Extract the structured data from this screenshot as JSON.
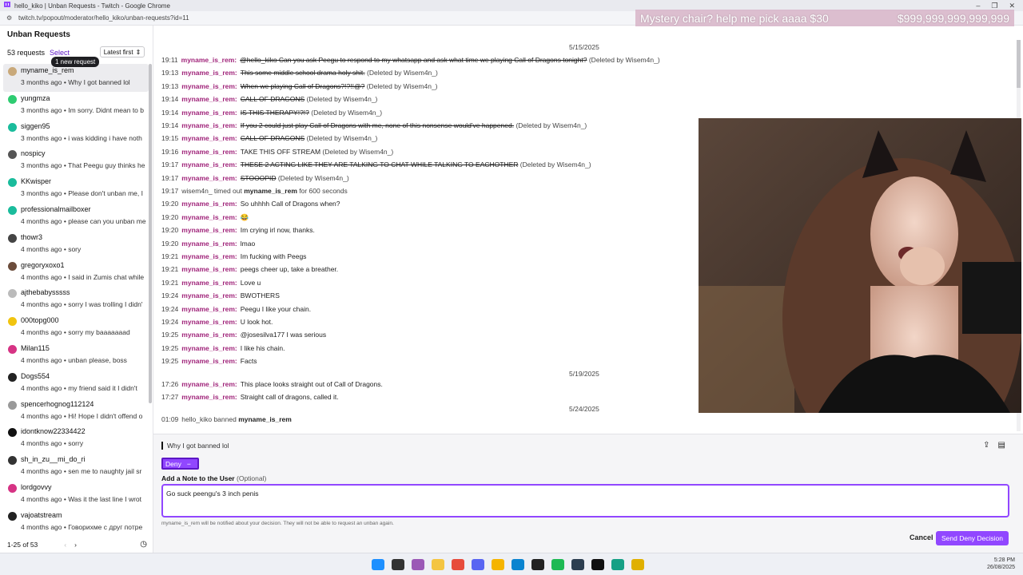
{
  "browser": {
    "title": "hello_kiko | Unban Requests - Twitch - Google Chrome",
    "url": "twitch.tv/popout/moderator/hello_kiko/unban-requests?id=11"
  },
  "overlay": {
    "left": "Mystery chair? help me pick aaaa $30",
    "right": "$999,999,999,999,999"
  },
  "sidebar": {
    "heading": "Unban Requests",
    "count": "53 requests",
    "select": "Select",
    "sort": "Latest first",
    "tooltip": "1 new request",
    "pager": "1-25 of 53",
    "items": [
      {
        "name": "myname_is_rem",
        "meta": "3 months ago • Why I got banned lol",
        "color": "#c9a97a"
      },
      {
        "name": "yungmza",
        "meta": "3 months ago • Im sorry. Didnt mean to b",
        "color": "#2ecc71"
      },
      {
        "name": "siggen95",
        "meta": "3 months ago • i was kidding i have noth",
        "color": "#1abc9c"
      },
      {
        "name": "nospicy",
        "meta": "3 months ago • That Peegu guy thinks he",
        "color": "#555555"
      },
      {
        "name": "KKwisper",
        "meta": "3 months ago • Please don't unban me, I",
        "color": "#1abc9c"
      },
      {
        "name": "professionalmailboxer",
        "meta": "4 months ago • please can you unban me",
        "color": "#1abc9c"
      },
      {
        "name": "thowr3",
        "meta": "4 months ago • sory",
        "color": "#444444"
      },
      {
        "name": "gregoryxoxo1",
        "meta": "4 months ago • I said in Zumis chat while",
        "color": "#6b4c3b"
      },
      {
        "name": "ajthebabysssss",
        "meta": "4 months ago • sorry I was trolling I didn'",
        "color": "#bbbbbb"
      },
      {
        "name": "000topg000",
        "meta": "4 months ago • sorry my baaaaaaad",
        "color": "#f1c40f"
      },
      {
        "name": "Milan115",
        "meta": "4 months ago • unban please, boss",
        "color": "#d63384"
      },
      {
        "name": "Dogs554",
        "meta": "4 months ago • my friend said it I didn't",
        "color": "#222222"
      },
      {
        "name": "spencerhognog112124",
        "meta": "4 months ago • Hi! Hope I didn't offend o",
        "color": "#999999"
      },
      {
        "name": "idontknow22334422",
        "meta": "4 months ago • sorry",
        "color": "#111111"
      },
      {
        "name": "sh_in_zu__mi_do_ri",
        "meta": "4 months ago • sen me to naughty jail sr",
        "color": "#333333"
      },
      {
        "name": "lordgovvy",
        "meta": "4 months ago • Was it the last line I wrot",
        "color": "#d63384"
      },
      {
        "name": "vajoatstream",
        "meta": "4 months ago • Говорихме с друг потре",
        "color": "#222222"
      }
    ]
  },
  "chat": {
    "dates": [
      "5/15/2025",
      "5/19/2025",
      "5/24/2025"
    ],
    "lines": [
      {
        "t": "19:11",
        "u": "myname_is_rem:",
        "m": "@hello_kiko Can you ask Peegu to respond to my whatsapp and ask what time we playing Call of Dragons tonight?",
        "del": true,
        "note": "(Deleted by Wisem4n_)"
      },
      {
        "t": "19:13",
        "u": "myname_is_rem:",
        "m": "This some middle school drama holy shit.",
        "del": true,
        "note": "(Deleted by Wisem4n_)"
      },
      {
        "t": "19:13",
        "u": "myname_is_rem:",
        "m": "When we playing Call of Dragons?!?!!@?",
        "del": true,
        "note": "(Deleted by Wisem4n_)"
      },
      {
        "t": "19:14",
        "u": "myname_is_rem:",
        "m": "CALL OF DRAGONS",
        "del": true,
        "note": "(Deleted by Wisem4n_)"
      },
      {
        "t": "19:14",
        "u": "myname_is_rem:",
        "m": "IS THIS THERAPY!?!?",
        "del": true,
        "note": "(Deleted by Wisem4n_)"
      },
      {
        "t": "19:14",
        "u": "myname_is_rem:",
        "m": "If you 2 could just play Call of Dragons with me, none of this nonsense would've happened.",
        "del": true,
        "note": "(Deleted by Wisem4n_)"
      },
      {
        "t": "19:15",
        "u": "myname_is_rem:",
        "m": "CALL OF DRAGONS",
        "del": true,
        "note": "(Deleted by Wisem4n_)"
      },
      {
        "t": "19:16",
        "u": "myname_is_rem:",
        "m": "TAKE THIS OFF STREAM",
        "del": false,
        "note": "(Deleted by Wisem4n_)"
      },
      {
        "t": "19:17",
        "u": "myname_is_rem:",
        "m": "THESE 2 ACTING LIKE THEY ARE TALKING TO CHAT WHILE TALKING TO EACHOTHER",
        "del": true,
        "note": "(Deleted by Wisem4n_)"
      },
      {
        "t": "19:17",
        "u": "myname_is_rem:",
        "m": "STOOOPID",
        "del": true,
        "note": "(Deleted by Wisem4n_)"
      },
      {
        "t": "19:17",
        "sys": "wisem4n_ timed out",
        "sysu": "myname_is_rem",
        "sysend": "for 600 seconds"
      },
      {
        "t": "19:20",
        "u": "myname_is_rem:",
        "m": "So uhhhh Call of Dragons when?"
      },
      {
        "t": "19:20",
        "u": "myname_is_rem:",
        "m": "😂"
      },
      {
        "t": "19:20",
        "u": "myname_is_rem:",
        "m": "Im crying irl now, thanks."
      },
      {
        "t": "19:20",
        "u": "myname_is_rem:",
        "m": "lmao"
      },
      {
        "t": "19:21",
        "u": "myname_is_rem:",
        "m": "Im fucking with Peegs"
      },
      {
        "t": "19:21",
        "u": "myname_is_rem:",
        "m": "peegs cheer up, take a breather."
      },
      {
        "t": "19:21",
        "u": "myname_is_rem:",
        "m": "Love u"
      },
      {
        "t": "19:24",
        "u": "myname_is_rem:",
        "m": "BWOTHERS"
      },
      {
        "t": "19:24",
        "u": "myname_is_rem:",
        "m": "Peegu I like your chain."
      },
      {
        "t": "19:24",
        "u": "myname_is_rem:",
        "m": "U look hot."
      },
      {
        "t": "19:25",
        "u": "myname_is_rem:",
        "m": "@josesilva177 I was serious"
      },
      {
        "t": "19:25",
        "u": "myname_is_rem:",
        "m": "I like his chain."
      },
      {
        "t": "19:25",
        "u": "myname_is_rem:",
        "m": "Facts"
      },
      {
        "t": "17:26",
        "u": "myname_is_rem:",
        "m": "This place looks straight out of Call of Dragons."
      },
      {
        "t": "17:27",
        "u": "myname_is_rem:",
        "m": "Straight call of dragons, called it."
      },
      {
        "t": "01:09",
        "sys": "hello_kiko banned",
        "sysu": "myname_is_rem",
        "sysend": ""
      }
    ]
  },
  "panel": {
    "request_message": "Why I got banned lol",
    "deny_label": "Deny",
    "note_label": "Add a Note to the User",
    "note_optional": "(Optional)",
    "note_value": "Go suck peengu's 3 inch penis",
    "hint": "myname_is_rem will be notified about your decision. They will not be able to request an unban again.",
    "cancel": "Cancel",
    "send": "Send Deny Decision"
  },
  "taskbar": {
    "time": "5:28 PM",
    "date": "26/08/2025"
  }
}
